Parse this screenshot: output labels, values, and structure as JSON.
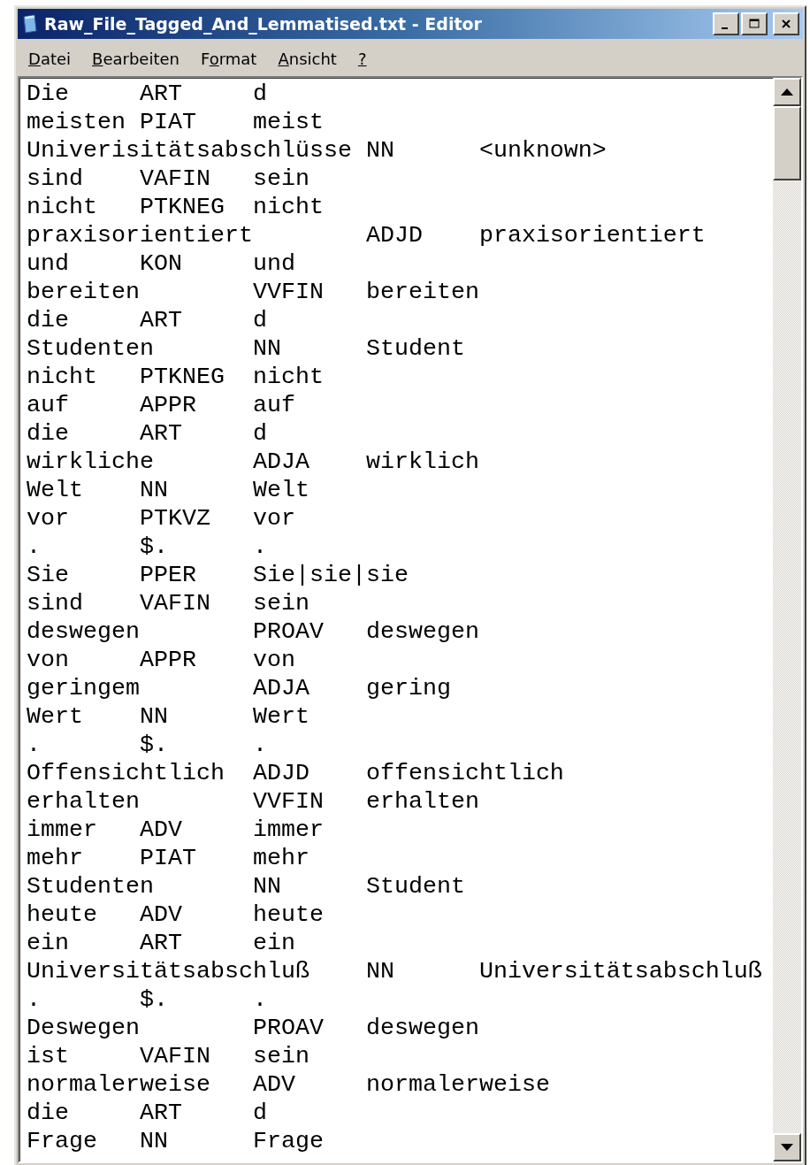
{
  "window": {
    "title": "Raw_File_Tagged_And_Lemmatised.txt - Editor"
  },
  "menu": [
    {
      "key": "D",
      "after": "atei"
    },
    {
      "key": "B",
      "after": "earbeiten"
    },
    {
      "before": "F",
      "key": "o",
      "after": "rmat"
    },
    {
      "key": "A",
      "after": "nsicht"
    },
    {
      "key": "?"
    }
  ],
  "lines": [
    "Die\tART\td",
    "meisten\tPIAT\tmeist",
    "Univerisitätsabschlüsse\tNN\t<unknown>",
    "sind\tVAFIN\tsein",
    "nicht\tPTKNEG\tnicht",
    "praxisorientiert\tADJD\tpraxisorientiert",
    "und\tKON\tund",
    "bereiten\tVVFIN\tbereiten",
    "die\tART\td",
    "Studenten\tNN\tStudent",
    "nicht\tPTKNEG\tnicht",
    "auf\tAPPR\tauf",
    "die\tART\td",
    "wirkliche\tADJA\twirklich",
    "Welt\tNN\tWelt",
    "vor\tPTKVZ\tvor",
    ".\t$.\t.",
    "Sie\tPPER\tSie|sie|sie",
    "sind\tVAFIN\tsein",
    "deswegen\tPROAV\tdeswegen",
    "von\tAPPR\tvon",
    "geringem\tADJA\tgering",
    "Wert\tNN\tWert",
    ".\t$.\t.",
    "Offensichtlich\tADJD\toffensichtlich",
    "erhalten\tVVFIN\terhalten",
    "immer\tADV\timmer",
    "mehr\tPIAT\tmehr",
    "Studenten\tNN\tStudent",
    "heute\tADV\theute",
    "ein\tART\tein",
    "Universitätsabschluß\tNN\tUniversitätsabschluß",
    ".\t$.\t.",
    "Deswegen\tPROAV\tdeswegen",
    "ist\tVAFIN\tsein",
    "normalerweise\tADV\tnormalerweise",
    "die\tART\td",
    "Frage\tNN\tFrage"
  ]
}
